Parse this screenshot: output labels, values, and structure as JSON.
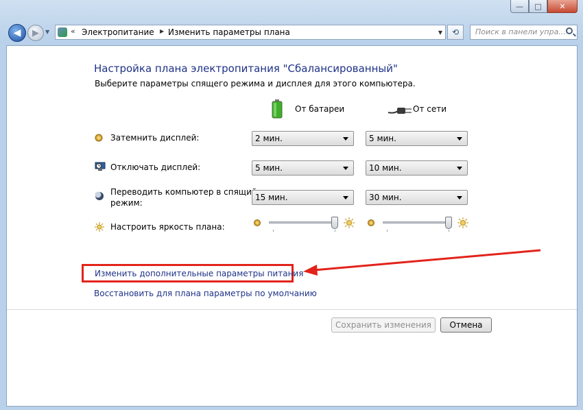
{
  "titlebar": {
    "min_glyph": "—",
    "max_glyph": "□",
    "close_glyph": "✕"
  },
  "nav": {
    "back_glyph": "◀",
    "forward_glyph": "▶",
    "breadcrumb_chevron": "«",
    "breadcrumb": [
      "Электропитание",
      "Изменить параметры плана"
    ],
    "refresh_glyph": "⟲",
    "search_placeholder": "Поиск в панели упра..."
  },
  "page": {
    "title": "Настройка плана электропитания \"Сбалансированный\"",
    "subtitle": "Выберите параметры спящего режима и дисплея для этого компьютера."
  },
  "columns": {
    "battery": "От батареи",
    "ac": "От сети"
  },
  "settings": [
    {
      "label": "Затемнить дисплей:",
      "battery": "2 мин.",
      "ac": "5 мин."
    },
    {
      "label": "Отключать дисплей:",
      "battery": "5 мин.",
      "ac": "10 мин."
    },
    {
      "label": "Переводить компьютер в спящий режим:",
      "label_line1": "Переводить компьютер в спящий",
      "label_line2": "режим:",
      "battery": "15 мин.",
      "ac": "30 мин."
    }
  ],
  "brightness": {
    "label": "Настроить яркость плана:",
    "battery_level": 1.0,
    "ac_level": 1.0
  },
  "links": {
    "advanced": "Изменить дополнительные параметры питания",
    "restore": "Восстановить для плана параметры по умолчанию"
  },
  "buttons": {
    "save": "Сохранить изменения",
    "cancel": "Отмена"
  },
  "colors": {
    "link": "#1e3287",
    "annotation": "#e2231a"
  }
}
